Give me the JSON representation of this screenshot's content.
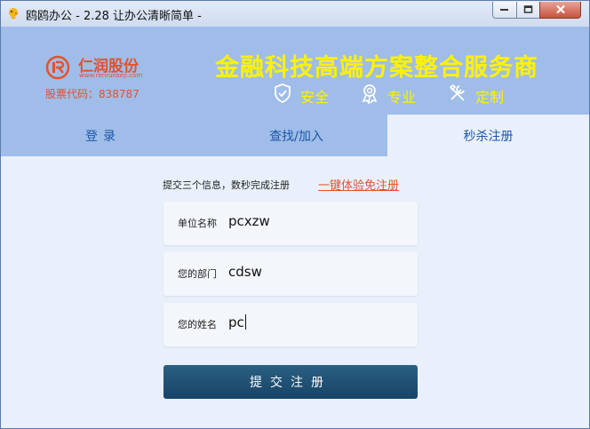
{
  "window": {
    "title": "鸥鸥办公 - 2.28 让办公清晰简单 -"
  },
  "banner": {
    "company_name": "仁润股份",
    "company_url": "www.renrunkeji.com",
    "stock_code": "股票代码：838787",
    "slogan": "金融科技高端方案整合服务商",
    "features": [
      {
        "icon": "shield-check-icon",
        "label": "安全"
      },
      {
        "icon": "medal-icon",
        "label": "专业"
      },
      {
        "icon": "tools-icon",
        "label": "定制"
      }
    ]
  },
  "tabs": [
    {
      "label": "登录",
      "active": false
    },
    {
      "label": "查找/加入",
      "active": false
    },
    {
      "label": "秒杀注册",
      "active": true
    }
  ],
  "form": {
    "hint": "提交三个信息，数秒完成注册",
    "quick_link": "一键体验免注册",
    "fields": [
      {
        "label": "单位名称",
        "value": "pcxzw"
      },
      {
        "label": "您的部门",
        "value": "cdsw"
      },
      {
        "label": "您的姓名",
        "value": "pc"
      }
    ],
    "submit_label": "提交注册"
  },
  "colors": {
    "accent": "#e3522b",
    "banner": "#9fbde8",
    "slogan": "#fff200",
    "button": "#1d4a6c",
    "tab_text": "#1d56a8"
  }
}
